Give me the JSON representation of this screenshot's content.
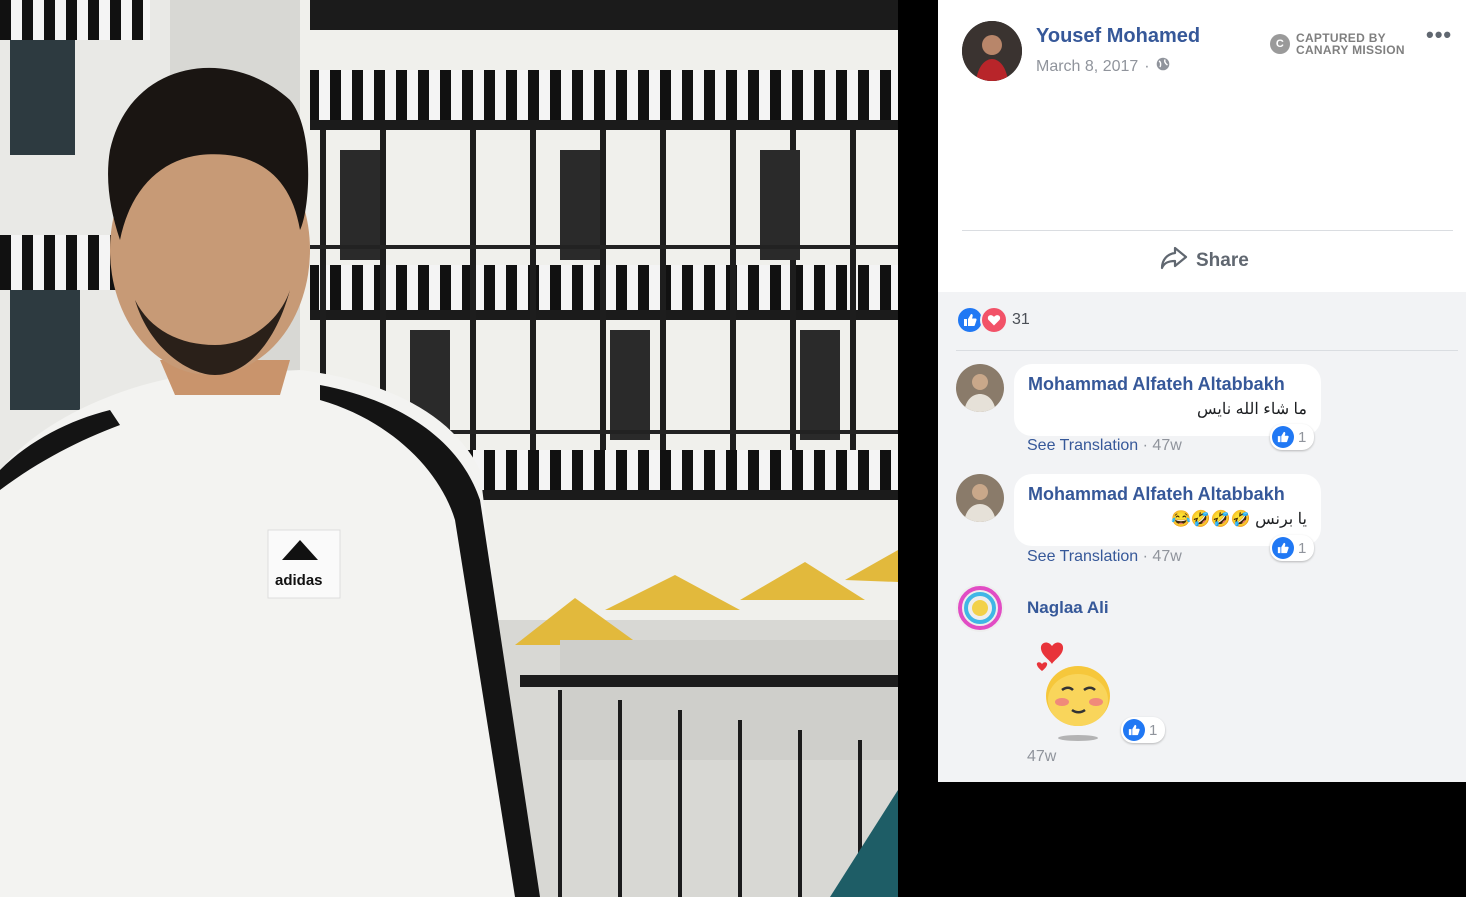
{
  "post": {
    "author": "Yousef Mohamed",
    "date": "March 8, 2017",
    "separator": "·",
    "badge_line1": "CAPTURED BY",
    "badge_line2": "CANARY MISSION",
    "more": "•••"
  },
  "actions": {
    "share_label": "Share"
  },
  "reactions": {
    "count": "31"
  },
  "comments": [
    {
      "name": "Mohammad Alfateh Altabbakh",
      "text": "ما شاء الله نايس",
      "translate": "See Translation",
      "time": "· 47w",
      "likes": "1"
    },
    {
      "name": "Mohammad Alfateh Altabbakh",
      "text": "يا برنس 🤣🤣🤣😂",
      "translate": "See Translation",
      "time": "· 47w",
      "likes": "1"
    },
    {
      "name": "Naglaa Ali",
      "time": "47w",
      "likes": "1"
    }
  ],
  "icons": {
    "globe": "globe-icon",
    "share": "share-arrow-icon",
    "like": "thumbs-up-icon",
    "love": "heart-icon",
    "more": "more-icon",
    "sticker": "blushing-emoji-sticker"
  },
  "colors": {
    "link": "#365899",
    "like": "#2078f4",
    "love": "#f25268",
    "muted": "#90949c"
  }
}
